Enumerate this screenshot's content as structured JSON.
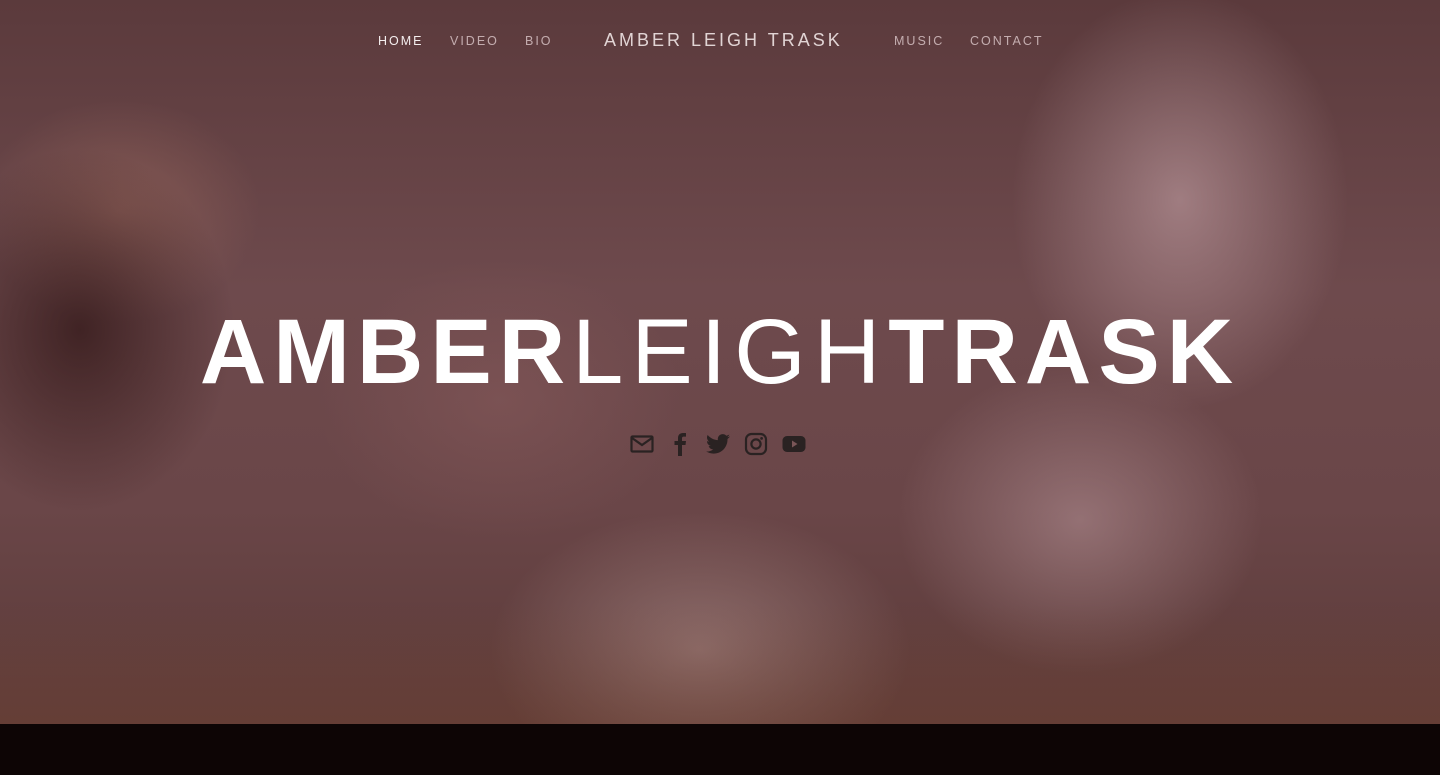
{
  "nav": {
    "home": "HOME",
    "video": "VIDEO",
    "bio": "BIO",
    "brand": "AMBER LEIGH TRASK",
    "music": "MUSIC",
    "contact": "CONTACT"
  },
  "hero": {
    "title_part1": "AMBER",
    "title_part2": "LEIGH",
    "title_part3": "TRASK"
  },
  "socials": [
    {
      "icon": "email-icon"
    },
    {
      "icon": "facebook-icon"
    },
    {
      "icon": "twitter-icon"
    },
    {
      "icon": "instagram-icon"
    },
    {
      "icon": "youtube-icon"
    }
  ],
  "colors": {
    "hero_overlay": "#6e4a4d",
    "icon": "#2a2222",
    "footer": "#0d0505",
    "text": "#ffffff"
  }
}
